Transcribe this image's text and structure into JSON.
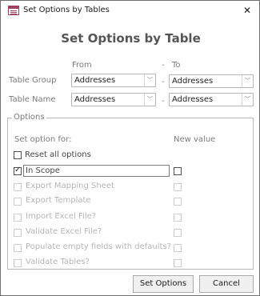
{
  "window": {
    "title": "Set Options by Tables",
    "close_glyph": "✕"
  },
  "heading": "Set Options by Table",
  "range": {
    "from_label": "From",
    "to_label": "To",
    "to_dash": "-",
    "dash": "-"
  },
  "table_group": {
    "label": "Table Group",
    "from_value": "Addresses",
    "to_value": "Addresses"
  },
  "table_name": {
    "label": "Table Name",
    "from_value": "Addresses",
    "to_value": "Addresses"
  },
  "options": {
    "legend": "Options",
    "set_for_label": "Set option for:",
    "new_value_label": "New value",
    "reset_all": {
      "label": "Reset all options",
      "checked": false
    },
    "items": [
      {
        "label": "In Scope",
        "checked": true,
        "enabled": true,
        "new_value": false
      },
      {
        "label": "Export Mapping Sheet",
        "checked": false,
        "enabled": false,
        "new_value": false
      },
      {
        "label": "Export Template",
        "checked": false,
        "enabled": false,
        "new_value": false
      },
      {
        "label": "Import Excel File?",
        "checked": false,
        "enabled": false,
        "new_value": false
      },
      {
        "label": "Validate Excel File?",
        "checked": false,
        "enabled": false,
        "new_value": false
      },
      {
        "label": "Populate empty fields with defaults?",
        "checked": false,
        "enabled": false,
        "new_value": false
      },
      {
        "label": "Validate Tables?",
        "checked": false,
        "enabled": false,
        "new_value": false
      }
    ]
  },
  "buttons": {
    "set_options": "Set Options",
    "cancel": "Cancel"
  },
  "icons": {
    "app": "table-icon",
    "dropdown": "chevron-down-icon",
    "close": "close-icon",
    "check": "checkmark-icon"
  },
  "colors": {
    "app_icon": "#a3405f",
    "disabled_text": "#b5b5b5"
  }
}
